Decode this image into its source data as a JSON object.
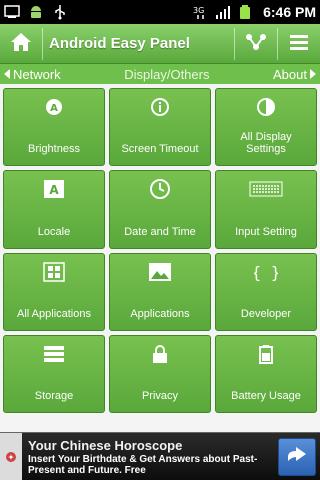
{
  "status_bar": {
    "time": "6:46 PM",
    "left_icons": [
      "usb-debug-icon",
      "android-icon",
      "usb-icon"
    ],
    "right_icons": [
      "network-data-icon",
      "signal-icon",
      "battery-icon"
    ]
  },
  "header": {
    "title": "Android Easy Panel",
    "home_icon": "home-icon",
    "share_icon": "share-icon",
    "menu_icon": "menu-icon"
  },
  "nav": {
    "left_label": "Network",
    "center_label": "Display/Others",
    "right_label": "About"
  },
  "tiles": [
    {
      "label": "Brightness",
      "icon": "brightness-icon"
    },
    {
      "label": "Screen Timeout",
      "icon": "info-icon"
    },
    {
      "label": "All Display Settings",
      "icon": "contrast-icon"
    },
    {
      "label": "Locale",
      "icon": "locale-icon"
    },
    {
      "label": "Date and Time",
      "icon": "clock-icon"
    },
    {
      "label": "Input Setting",
      "icon": "keyboard-icon"
    },
    {
      "label": "All Applications",
      "icon": "apps-grid-icon"
    },
    {
      "label": "Applications",
      "icon": "image-icon"
    },
    {
      "label": "Developer",
      "icon": "braces-icon"
    },
    {
      "label": "Storage",
      "icon": "storage-icon"
    },
    {
      "label": "Privacy",
      "icon": "lock-icon"
    },
    {
      "label": "Battery Usage",
      "icon": "battery-usage-icon"
    }
  ],
  "ad": {
    "title": "Your Chinese Horoscope",
    "body": "Insert Your Birthdate & Get Answers about Past-Present and Future. Free",
    "arrow_icon": "arrow-right-icon"
  },
  "colors": {
    "header_green": "#6fbf4c",
    "tile_green": "#6ab646",
    "tile_border": "#3e8724",
    "status_bg": "#000000",
    "ad_bg": "#1a1a1a",
    "ad_button": "#3f76c6"
  }
}
